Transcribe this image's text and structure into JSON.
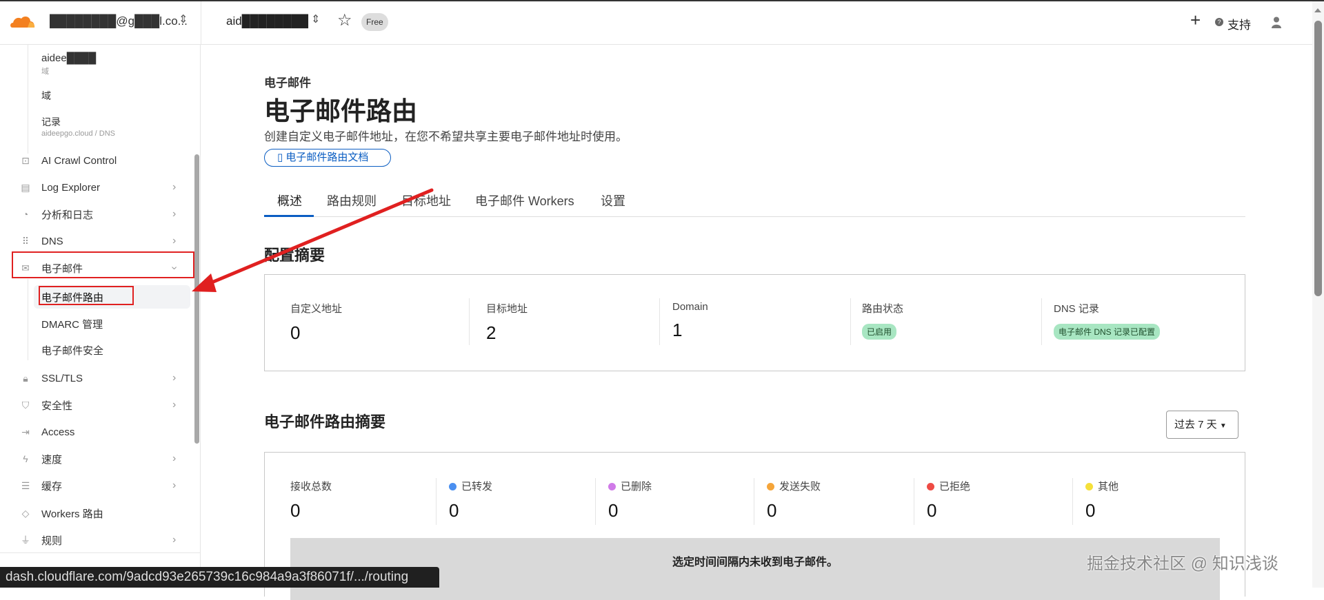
{
  "header": {
    "account": "████████@g███l.co...",
    "domain": "aid████████",
    "plan_badge": "Free",
    "support": "支持",
    "icons": [
      "cloudflare-logo",
      "chevron-updown-icon",
      "star-icon",
      "plus-icon",
      "help-icon",
      "user-icon"
    ]
  },
  "sidebar": {
    "context": {
      "domain_name": "aidee████",
      "domain_sub": "域",
      "domains": "域",
      "records": "记录",
      "records_path": "aideepgo.cloud / DNS"
    },
    "items": [
      {
        "label": "AI Crawl Control",
        "icon": "robot-icon"
      },
      {
        "label": "Log Explorer",
        "icon": "log-icon"
      },
      {
        "label": "分析和日志",
        "icon": "chart-pie-icon"
      },
      {
        "label": "DNS",
        "icon": "network-icon"
      },
      {
        "label": "电子邮件",
        "icon": "mail-icon"
      },
      {
        "label": "SSL/TLS",
        "icon": "lock-icon"
      },
      {
        "label": "安全性",
        "icon": "shield-icon"
      },
      {
        "label": "Access",
        "icon": "access-icon"
      },
      {
        "label": "速度",
        "icon": "bolt-icon"
      },
      {
        "label": "缓存",
        "icon": "cache-icon"
      },
      {
        "label": "Workers 路由",
        "icon": "workers-icon"
      },
      {
        "label": "规则",
        "icon": "rules-icon"
      }
    ],
    "email_sub": [
      "电子邮件路由",
      "DMARC 管理",
      "电子邮件安全"
    ]
  },
  "main": {
    "eyebrow": "电子邮件",
    "title": "电子邮件路由",
    "description": "创建自定义电子邮件地址，在您不希望共享主要电子邮件地址时使用。",
    "doc_button": "电子邮件路由文档",
    "tabs": [
      "概述",
      "路由规则",
      "目标地址",
      "电子邮件 Workers",
      "设置"
    ],
    "config_title": "配置摘要",
    "config": [
      {
        "label": "自定义地址",
        "value": "0"
      },
      {
        "label": "目标地址",
        "value": "2"
      },
      {
        "label": "Domain",
        "value": "1"
      },
      {
        "label": "路由状态",
        "badge": "已启用"
      },
      {
        "label": "DNS 记录",
        "badge": "电子邮件 DNS 记录已配置"
      }
    ],
    "summary_title": "电子邮件路由摘要",
    "range": "过去 7 天",
    "summary": [
      {
        "label": "接收总数",
        "value": "0",
        "color": ""
      },
      {
        "label": "已转发",
        "value": "0",
        "color": "#4a8ff0"
      },
      {
        "label": "已删除",
        "value": "0",
        "color": "#d07ae8"
      },
      {
        "label": "发送失败",
        "value": "0",
        "color": "#f5a53a"
      },
      {
        "label": "已拒绝",
        "value": "0",
        "color": "#ee4b44"
      },
      {
        "label": "其他",
        "value": "0",
        "color": "#f5e03a"
      }
    ],
    "empty": "选定时间间隔内未收到电子邮件。"
  },
  "status_url": "dash.cloudflare.com/9adcd93e265739c16c984a9a3f86071f/.../routing",
  "watermark": "掘金技术社区 @ 知识浅谈",
  "colors": {
    "accent": "#0a5dc2",
    "annotation": "#e02020"
  }
}
